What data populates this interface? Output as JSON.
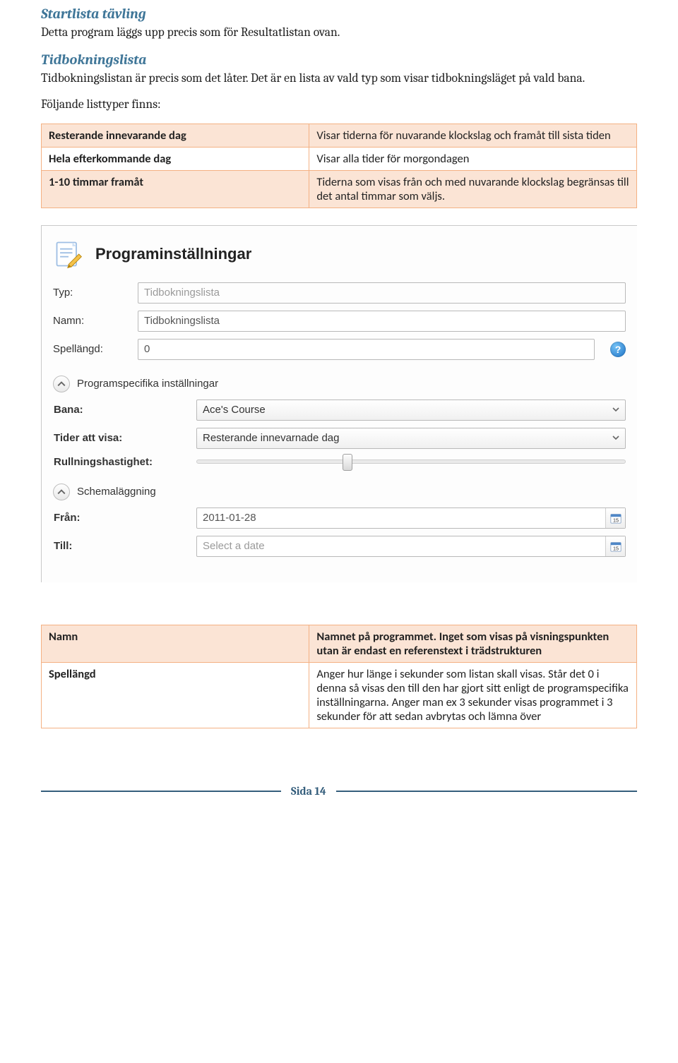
{
  "section1": {
    "title": "Startlista tävling",
    "body": "Detta program läggs upp precis som för Resultatlistan ovan."
  },
  "section2": {
    "title": "Tidbokningslista",
    "body": "Tidbokningslistan är precis som det låter. Det är en lista av vald typ som visar tidbokningsläget på vald bana.",
    "body2": "Följande listtyper finns:"
  },
  "table1": {
    "rows": [
      {
        "k": "Resterande innevarande dag",
        "v": "Visar tiderna för nuvarande klockslag och framåt till sista tiden"
      },
      {
        "k": "Hela efterkommande dag",
        "v": "Visar alla tider  för morgondagen"
      },
      {
        "k": "1-10 timmar framåt",
        "v": "Tiderna som visas från och med nuvarande klockslag  begränsas till det antal timmar som väljs."
      }
    ]
  },
  "form": {
    "heading": "Programinställningar",
    "typ_label": "Typ:",
    "typ_value": "Tidbokningslista",
    "namn_label": "Namn:",
    "namn_value": "Tidbokningslista",
    "spellangd_label": "Spellängd:",
    "spellangd_value": "0",
    "help_q": "?",
    "prog_section": "Programspecifika inställningar",
    "bana_label": "Bana:",
    "bana_value": "Ace's Course",
    "tider_label": "Tider att visa:",
    "tider_value": "Resterande innevarnade dag",
    "rull_label": "Rullningshastighet:",
    "schema_section": "Schemaläggning",
    "fran_label": "Från:",
    "fran_value": "2011-01-28",
    "till_label": "Till:",
    "till_value": "Select a date",
    "cal_badge": "15"
  },
  "table2": {
    "rows": [
      {
        "k": "Namn",
        "v": "Namnet på programmet. Inget som visas på visningspunkten utan är endast en referenstext i trädstrukturen"
      },
      {
        "k": "Spellängd",
        "v": "Anger hur länge i sekunder som listan skall visas. Står det 0 i denna så visas den till den har gjort sitt enligt de programspecifika inställningarna. Anger man ex 3 sekunder visas programmet i 3 sekunder för att sedan avbrytas och lämna över"
      }
    ]
  },
  "footer": {
    "page": "Sida 14"
  }
}
